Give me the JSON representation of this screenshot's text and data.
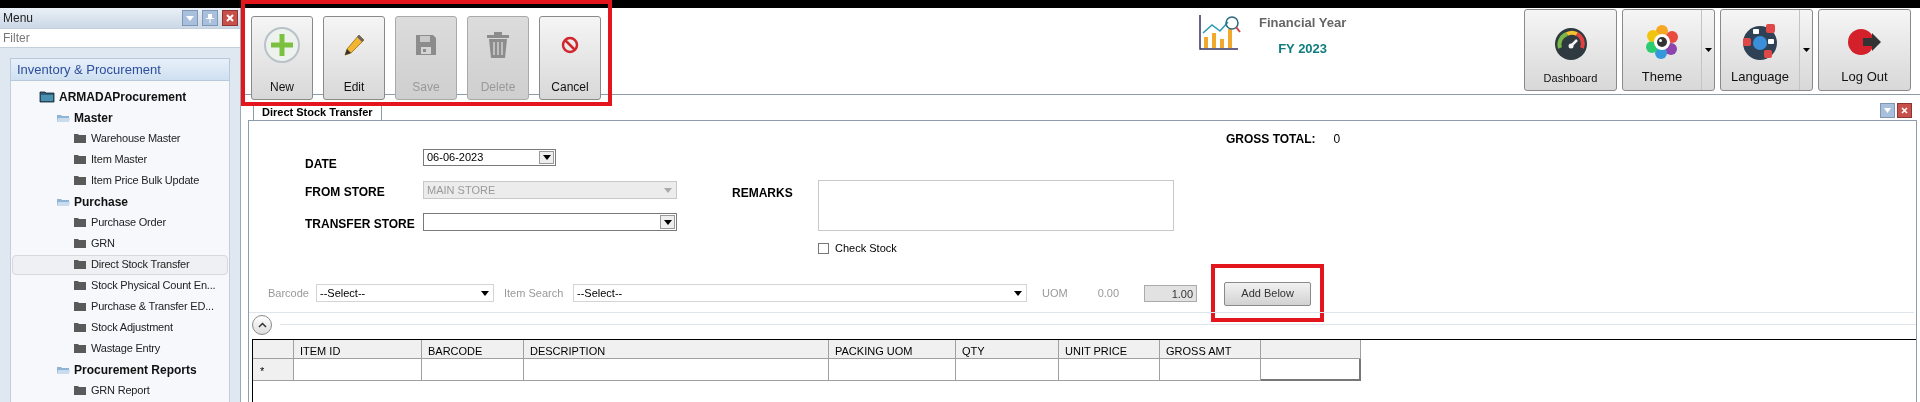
{
  "menu_panel": {
    "title": "Menu",
    "filter": {
      "placeholder": "Filter"
    }
  },
  "nav_group": {
    "title": "Inventory & Procurement",
    "tree": [
      {
        "label": "ARMADAProcurement",
        "kind": "root",
        "selected": false,
        "children": [
          {
            "label": "Master",
            "kind": "group",
            "selected": false,
            "children": [
              {
                "label": "Warehouse Master",
                "kind": "item",
                "selected": false
              },
              {
                "label": "Item Master",
                "kind": "item",
                "selected": false
              },
              {
                "label": "Item Price Bulk Update",
                "kind": "item",
                "selected": false
              }
            ]
          },
          {
            "label": "Purchase",
            "kind": "group",
            "selected": false,
            "children": [
              {
                "label": "Purchase Order",
                "kind": "item",
                "selected": false
              },
              {
                "label": "GRN",
                "kind": "item",
                "selected": false
              },
              {
                "label": "Direct Stock Transfer",
                "kind": "item",
                "selected": true
              },
              {
                "label": "Stock Physical Count En...",
                "kind": "item",
                "selected": false
              },
              {
                "label": "Purchase & Transfer ED...",
                "kind": "item",
                "selected": false
              },
              {
                "label": "Stock Adjustment",
                "kind": "item",
                "selected": false
              },
              {
                "label": "Wastage Entry",
                "kind": "item",
                "selected": false
              }
            ]
          },
          {
            "label": "Procurement Reports",
            "kind": "group",
            "selected": false,
            "children": [
              {
                "label": "GRN Report",
                "kind": "item",
                "selected": false
              }
            ]
          }
        ]
      }
    ]
  },
  "toolbar": {
    "highlighted": true,
    "buttons": [
      {
        "label": "New",
        "kind": "new",
        "disabled": false
      },
      {
        "label": "Edit",
        "kind": "edit",
        "disabled": false
      },
      {
        "label": "Save",
        "kind": "save",
        "disabled": true
      },
      {
        "label": "Delete",
        "kind": "delete",
        "disabled": true
      },
      {
        "label": "Cancel",
        "kind": "cancel",
        "disabled": false
      }
    ]
  },
  "financial_year": {
    "title": "Financial Year",
    "value": "FY 2023"
  },
  "header_buttons": [
    {
      "label": "Dashboard",
      "kind": "dashboard",
      "has_dropdown": false
    },
    {
      "label": "Theme",
      "kind": "theme",
      "has_dropdown": true
    },
    {
      "label": "Language",
      "kind": "language",
      "has_dropdown": true
    },
    {
      "label": "Log Out",
      "kind": "logout",
      "has_dropdown": false
    }
  ],
  "document_tab": {
    "title": "Direct Stock Transfer",
    "selected": true
  },
  "form": {
    "gross_total": {
      "label": "GROSS TOTAL:",
      "value": "0"
    },
    "date": {
      "label": "DATE",
      "value": "06-06-2023"
    },
    "from_store": {
      "label": "FROM STORE",
      "value": "MAIN STORE",
      "disabled": true
    },
    "transfer_store": {
      "label": "TRANSFER STORE",
      "disabled": false
    },
    "remarks": {
      "label": "REMARKS"
    },
    "check_stock": {
      "label": "Check Stock",
      "checked": false
    }
  },
  "item_entry": {
    "barcode": {
      "label": "Barcode",
      "value": "--Select--"
    },
    "item_search": {
      "label": "Item Search",
      "value": "--Select--"
    },
    "uom": {
      "label": "UOM",
      "value": "0.00"
    },
    "qty": {
      "value": "1.00"
    },
    "add_button": {
      "label": "Add Below",
      "highlighted": true
    }
  },
  "grid": {
    "columns": [
      "ITEM ID",
      "BARCODE",
      "DESCRIPTION",
      "PACKING UOM",
      "QTY",
      "UNIT PRICE",
      "GROSS AMT"
    ],
    "new_row_marker": "*"
  }
}
